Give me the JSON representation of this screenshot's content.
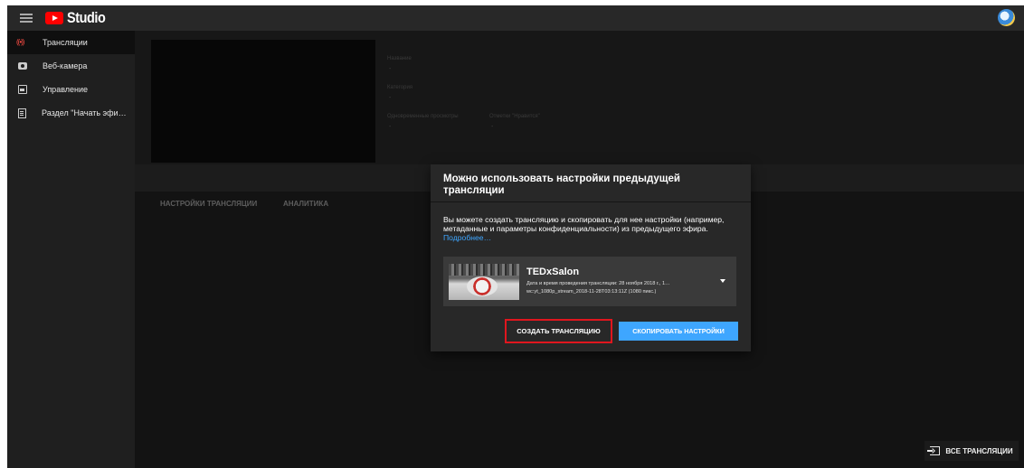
{
  "app": {
    "logo_text": "Studio"
  },
  "sidebar": {
    "items": [
      {
        "label": "Трансляции",
        "icon": "live-broadcast-icon",
        "active": true
      },
      {
        "label": "Веб-камера",
        "icon": "camera-icon",
        "active": false
      },
      {
        "label": "Управление",
        "icon": "calendar-icon",
        "active": false
      },
      {
        "label": "Раздел \"Начать эфи…",
        "icon": "document-icon",
        "active": false
      }
    ]
  },
  "preview": {
    "title_label": "Название",
    "title_value": "-",
    "category_label": "Категория",
    "category_value": "-",
    "concurrent_label": "Одновременные просмотры",
    "concurrent_value": "-",
    "likes_label": "Отметки \"Нравится\"",
    "likes_value": "-"
  },
  "tabs": [
    {
      "label": "НАСТРОЙКИ ТРАНСЛЯЦИИ"
    },
    {
      "label": "АНАЛИТИКА"
    }
  ],
  "dialog": {
    "title": "Можно использовать настройки предыдущей трансляции",
    "description": "Вы можете создать трансляцию и скопировать для нее настройки (например, метаданные и параметры конфиденциальности) из предыдущего эфира.",
    "link": "Подробнее…",
    "stream_card": {
      "title": "TEDxSalon",
      "line1": "Дата и время проведения трансляции: 28 ноября 2018 г., 1…",
      "line2": "wc:yt_1080p_stream_2018-11-28T03:13:11Z (1080 пикс.)"
    },
    "create_button": "СОЗДАТЬ ТРАНСЛЯЦИЮ",
    "copy_button": "СКОПИРОВАТЬ НАСТРОЙКИ"
  },
  "footer": {
    "all_streams": "ВСЕ ТРАНСЛЯЦИИ"
  },
  "colors": {
    "accent_blue": "#3ea6ff",
    "highlight_red": "#e0161e",
    "live_red": "#ff4e45",
    "youtube_red": "#ff0000"
  }
}
